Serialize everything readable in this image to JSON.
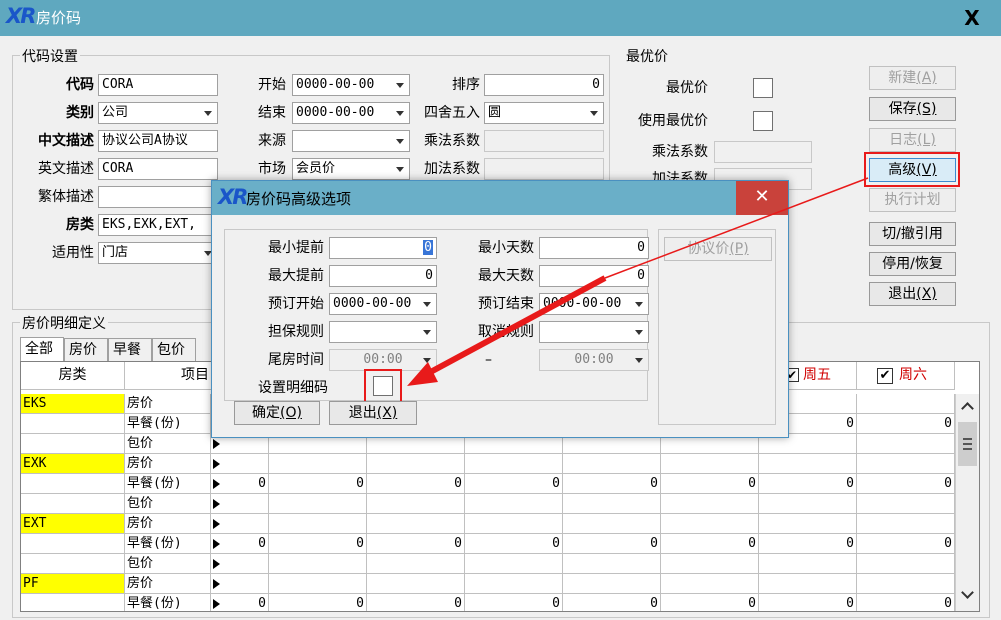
{
  "window": {
    "logo": "XR",
    "title": "房价码",
    "close": "X"
  },
  "code_settings": {
    "group_label": "代码设置",
    "rows": [
      {
        "label": "代码",
        "value": "CORA"
      },
      {
        "label": "类别",
        "value": "公司"
      },
      {
        "label": "中文描述",
        "value": "协议公司A协议"
      },
      {
        "label": "英文描述",
        "value": "CORA"
      },
      {
        "label": "繁体描述",
        "value": ""
      },
      {
        "label": "房类",
        "value": "EKS,EXK,EXT,"
      },
      {
        "label": "适用性",
        "value": "门店"
      }
    ],
    "start_label": "开始",
    "start_value": "0000-00-00",
    "end_label": "结束",
    "end_value": "0000-00-00",
    "source_label": "来源",
    "source_value": "",
    "market_label": "市场",
    "market_value": "会员价",
    "sort_label": "排序",
    "sort_value": "0",
    "round_label": "四舍五入",
    "round_value": "圆",
    "mult_label": "乘法系数",
    "add_label": "加法系数"
  },
  "best_price": {
    "group_label": "最优价",
    "best_label": "最优价",
    "use_best_label": "使用最优价",
    "mult_label": "乘法系数",
    "add_label": "加法系数"
  },
  "buttons": {
    "new": "新建",
    "new_key": "(A)",
    "save": "保存",
    "save_key": "(S)",
    "log": "日志",
    "log_key": "(L)",
    "advanced": "高级",
    "advanced_key": "(V)",
    "plan": "执行计划",
    "ref": "切/撤引用",
    "disable": "停用/恢复",
    "exit": "退出",
    "exit_key": "(X)"
  },
  "detail": {
    "group_label": "房价明细定义",
    "tabs": [
      "全部",
      "房价",
      "早餐",
      "包价"
    ],
    "col_room": "房类",
    "col_item": "项目",
    "fri": "周五",
    "sat": "周六",
    "rows": [
      {
        "room": "EKS",
        "item": "房价",
        "vals": [
          "",
          "",
          "",
          "",
          "",
          "",
          "",
          "",
          ""
        ]
      },
      {
        "room": "",
        "item": "早餐(份)",
        "vals": [
          "",
          "",
          "",
          "",
          "",
          "",
          "",
          "0",
          "0"
        ]
      },
      {
        "room": "",
        "item": "包价",
        "vals": [
          "",
          "",
          "",
          "",
          "",
          "",
          "",
          "",
          ""
        ]
      },
      {
        "room": "EXK",
        "item": "房价",
        "vals": [
          "",
          "",
          "",
          "",
          "",
          "",
          "",
          "",
          ""
        ]
      },
      {
        "room": "",
        "item": "早餐(份)",
        "vals": [
          "",
          "0",
          "0",
          "0",
          "0",
          "0",
          "0",
          "0",
          "0"
        ]
      },
      {
        "room": "",
        "item": "包价",
        "vals": [
          "",
          "",
          "",
          "",
          "",
          "",
          "",
          "",
          ""
        ]
      },
      {
        "room": "EXT",
        "item": "房价",
        "vals": [
          "",
          "",
          "",
          "",
          "",
          "",
          "",
          "",
          ""
        ]
      },
      {
        "room": "",
        "item": "早餐(份)",
        "vals": [
          "",
          "0",
          "0",
          "0",
          "0",
          "0",
          "0",
          "0",
          "0"
        ]
      },
      {
        "room": "",
        "item": "包价",
        "vals": [
          "",
          "",
          "",
          "",
          "",
          "",
          "",
          "",
          ""
        ]
      },
      {
        "room": "PF",
        "item": "房价",
        "vals": [
          "",
          "",
          "",
          "",
          "",
          "",
          "",
          "",
          ""
        ]
      },
      {
        "room": "",
        "item": "早餐(份)",
        "vals": [
          "",
          "0",
          "0",
          "0",
          "0",
          "0",
          "0",
          "0",
          "0"
        ]
      }
    ]
  },
  "dialog": {
    "logo": "XR",
    "title": "房价码高级选项",
    "close": "✕",
    "min_adv_label": "最小提前",
    "min_adv_value": "0",
    "max_adv_label": "最大提前",
    "max_adv_value": "0",
    "min_days_label": "最小天数",
    "min_days_value": "0",
    "max_days_label": "最大天数",
    "max_days_value": "0",
    "book_start_label": "预订开始",
    "book_start_value": "0000-00-00",
    "book_end_label": "预订结束",
    "book_end_value": "0000-00-00",
    "guarantee_label": "担保规则",
    "cancel_label": "取消规则",
    "tail_label": "尾房时间",
    "tail_from": "00:00",
    "tail_sep": "–",
    "tail_to": "00:00",
    "detail_code_label": "设置明细码",
    "contract_btn": "协议价",
    "contract_key": "(P)",
    "ok": "确定",
    "ok_key": "(O)",
    "exit": "退出",
    "exit_key": "(X)"
  }
}
